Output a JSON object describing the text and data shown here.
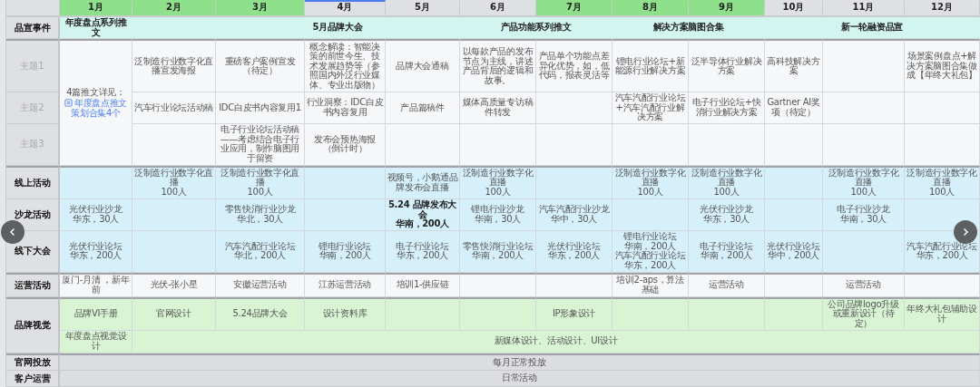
{
  "months": [
    {
      "label": "1月",
      "highlighted": true,
      "selected": false
    },
    {
      "label": "2月",
      "highlighted": true,
      "selected": false
    },
    {
      "label": "3月",
      "highlighted": true,
      "selected": false
    },
    {
      "label": "4月",
      "highlighted": false,
      "selected": true
    },
    {
      "label": "5月",
      "highlighted": false,
      "selected": false
    },
    {
      "label": "6月",
      "highlighted": false,
      "selected": false
    },
    {
      "label": "7月",
      "highlighted": true,
      "selected": false
    },
    {
      "label": "8月",
      "highlighted": true,
      "selected": false
    },
    {
      "label": "9月",
      "highlighted": true,
      "selected": false
    },
    {
      "label": "10月",
      "highlighted": false,
      "selected": false
    },
    {
      "label": "11月",
      "highlighted": false,
      "selected": false
    },
    {
      "label": "12月",
      "highlighted": false,
      "selected": false
    }
  ],
  "sections": [
    {
      "label": "品宣事件",
      "kind": "event",
      "lines": [
        [
          {
            "texts": [
              "年度盘点系列推文"
            ]
          },
          {
            "texts": [
              "5月品牌大会"
            ]
          },
          {
            "texts": [
              "产品功能系列推文"
            ]
          },
          {
            "texts": [
              "解决方案脑图合集"
            ]
          },
          {
            "texts": [
              "新一轮融资品宣"
            ]
          }
        ]
      ]
    },
    {
      "label": "主题1",
      "kind": "topic",
      "lines": [
        [
          {
            "texts": [
              "4篇推文详见："
            ],
            "link": "年度盘点推文策划合集4个"
          },
          {
            "texts": [
              "泛制造行业数字化直播宣发海报"
            ]
          },
          {
            "texts": [
              "重磅客户案例宣发（待定）"
            ]
          },
          {
            "texts": [
              "概念解读：智能决策的前世今生、技术发展趋势等（参照国内外泛行业媒体、专业出版物）"
            ]
          },
          {
            "texts": [
              "品牌大会通稿"
            ]
          },
          {
            "texts": [
              "以每款产品的发布节点为主线，讲述产品背后的逻辑和故事。"
            ]
          },
          {
            "texts": [
              "产品单个功能点差异化优势，如，低代码，报表灵活等"
            ]
          },
          {
            "texts": [
              "锂电行业论坛+新能源行业解决方案"
            ]
          },
          {
            "texts": [
              "泛半导体行业解决方案"
            ]
          },
          {
            "texts": [
              "高科技解决方案"
            ]
          },
          {
            "texts": [
              "场景案例盘点+解决方案脑图合集做成【年终大礼包】"
            ]
          }
        ]
      ]
    },
    {
      "label": "主题2",
      "kind": "topic",
      "lines": [
        [
          {
            "texts": [
              "汽车行业论坛活动稿"
            ]
          },
          {
            "texts": [
              "IDC白皮书内容复用1"
            ]
          },
          {
            "texts": [
              "行业洞察：IDC白皮书内容复用"
            ]
          },
          {
            "texts": [
              "产品篇稿件"
            ]
          },
          {
            "texts": [
              "媒体高质量专访稿件转发"
            ]
          },
          {
            "texts": [
              "汽车汽配行业论坛+汽车汽配行业解决方案"
            ]
          },
          {
            "texts": [
              "电子行业论坛+快消行业解决方案"
            ]
          },
          {
            "texts": [
              "Gartner AI奖项（待定）"
            ]
          }
        ]
      ]
    },
    {
      "label": "主题3",
      "kind": "topic",
      "lines": [
        [
          {
            "texts": [
              "电子行业论坛活动稿——考虑结合电子行业应用，制作脑图用于留资"
            ]
          },
          {
            "texts": [
              "发布会预热海报（倒计时）"
            ]
          }
        ]
      ]
    },
    {
      "label": "线上活动",
      "kind": "activity",
      "lines": [
        [
          {
            "texts": [
              "泛制造行业数字化直播",
              "100人"
            ]
          },
          {
            "texts": [
              "泛制造行业数字化直播",
              "100人"
            ]
          },
          {
            "texts": [
              "视频号，小鹅通品牌发布会直播"
            ]
          },
          {
            "texts": [
              "泛制造行业数字化直播",
              "100人"
            ]
          },
          {
            "texts": [
              "泛制造行业数字化直播",
              "100人"
            ]
          },
          {
            "texts": [
              "泛制造行业数字化直播",
              "100人"
            ]
          },
          {
            "texts": [
              "泛制造行业数字化直播",
              "100人"
            ]
          },
          {
            "texts": [
              "泛制造行业数字化直播",
              "100人"
            ]
          }
        ]
      ]
    },
    {
      "label": "沙龙活动",
      "kind": "activity",
      "lines": [
        [
          {
            "texts": [
              "光伏行业沙龙",
              "华东，30人"
            ]
          },
          {
            "texts": [
              "零售快消行业沙龙",
              "华北，30人"
            ]
          },
          {
            "texts": [
              "5.24 品牌发布大会",
              "华南，200人"
            ],
            "bold": true
          },
          {
            "texts": [
              "锂电行业沙龙",
              "华南，30人"
            ]
          },
          {
            "texts": [
              "汽车汽配行业沙龙",
              "华中，30人"
            ]
          },
          {
            "texts": [
              "光伏行业沙龙",
              "华东，30人"
            ]
          },
          {
            "texts": [
              "电子行业沙龙",
              "华南，30人"
            ]
          }
        ]
      ]
    },
    {
      "label": "线下大会",
      "kind": "activity",
      "lines": [
        [
          {
            "texts": [
              "光伏行业论坛",
              "华东，200人"
            ]
          },
          {
            "texts": [
              "汽车汽配行业论坛",
              "华北，200人"
            ]
          },
          {
            "texts": [
              "锂电行业论坛",
              "华南，200人"
            ]
          },
          {
            "texts": [
              "电子行业论坛",
              "华东，200人"
            ]
          },
          {
            "texts": [
              "零售快消行业论坛",
              "华南，200人"
            ]
          },
          {
            "texts": [
              "光伏行业论坛",
              "华东，200人"
            ]
          },
          {
            "texts": [
              "锂电行业论坛",
              "华南，200人",
              "汽车汽配行业论坛",
              "华东，200人"
            ]
          },
          {
            "texts": [
              "电子行业论坛",
              "华南，200人"
            ]
          },
          {
            "texts": [
              "光伏行业论坛",
              "华中，200人"
            ]
          },
          {
            "texts": [
              "汽车汽配行业论坛",
              "华东，200人"
            ]
          }
        ]
      ]
    },
    {
      "label": "运营活动",
      "kind": "ops",
      "lines": [
        [
          {
            "texts": [
              "厦门-月清 ，新年前"
            ]
          },
          {
            "texts": [
              "光伏-张小星"
            ]
          },
          {
            "texts": [
              "安徽运营活动"
            ]
          },
          {
            "texts": [
              "江苏运营活动"
            ]
          },
          {
            "texts": [
              "培训1-供应链"
            ]
          },
          {
            "texts": [
              "培训2-aps，算法基础"
            ]
          },
          {
            "texts": [
              "运营活动"
            ]
          },
          {
            "texts": [
              "运营活动"
            ]
          }
        ]
      ]
    },
    {
      "label": "品牌视觉",
      "kind": "visual",
      "lines": [
        [
          {
            "texts": [
              "品牌VI手册"
            ]
          },
          {
            "texts": [
              "官网设计"
            ]
          },
          {
            "texts": [
              "5.24品牌大会"
            ]
          },
          {
            "texts": [
              "设计资料库"
            ]
          },
          {
            "texts": [
              "IP形象设计"
            ]
          },
          {
            "texts": [
              "公司品牌logo升级或重新设计（待定）"
            ]
          },
          {
            "texts": [
              "年终大礼包辅助设计"
            ]
          }
        ],
        [
          {
            "texts": [
              "年度盘点视觉设计"
            ]
          },
          {
            "texts": [
              "新媒体设计、活动设计、UI设计"
            ]
          }
        ]
      ]
    },
    {
      "label": "官网投放",
      "kind": "channel",
      "lines": [
        [
          {
            "texts": [
              "每月正常投放"
            ]
          }
        ]
      ]
    },
    {
      "label": "客户运营",
      "kind": "channel",
      "lines": [
        [
          {
            "texts": [
              "日常活动"
            ]
          }
        ]
      ]
    }
  ]
}
